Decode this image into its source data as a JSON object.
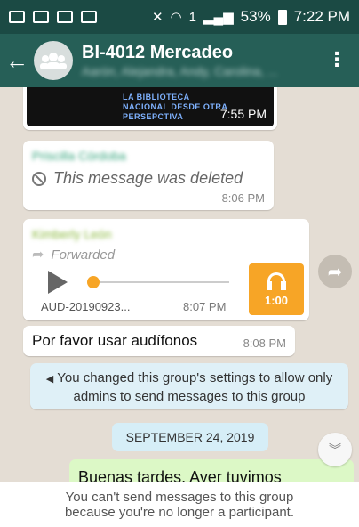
{
  "status_bar": {
    "battery": "53%",
    "time": "7:22 PM",
    "sim_label": "1"
  },
  "header": {
    "title": "BI-4012 Mercadeo",
    "members": "Aarón, Alejandra, Andy, Carolina, ..."
  },
  "messages": {
    "image": {
      "caption_line1": "LA BIBLIOTECA",
      "caption_line2": "NACIONAL DESDE OTRA",
      "caption_line3": "PERSEPCTIVA",
      "time": "7:55 PM"
    },
    "deleted": {
      "sender": "Priscilla Córdoba",
      "text": "This message was deleted",
      "time": "8:06 PM"
    },
    "audio": {
      "sender": "Kimberly León",
      "forwarded_label": "Forwarded",
      "file_name": "AUD-20190923...",
      "time": "8:07 PM",
      "duration": "1:00",
      "progress": 0.0
    },
    "text": {
      "body": "Por favor usar audífonos",
      "time": "8:08 PM"
    },
    "system": {
      "text": "You changed this group's settings to allow only admins to send messages to this group"
    },
    "date_separator": "SEPTEMBER 24, 2019",
    "partial": {
      "text": "Buenas tardes. Ayer tuvimos"
    }
  },
  "footer": {
    "text": "You can't send messages to this group because you're no longer a participant."
  },
  "colors": {
    "app_bar": "#265f57",
    "status_bar": "#1b4a44",
    "chat_background": "#e4ddd4",
    "accent_orange": "#f7a526",
    "outgoing_bubble": "#dcf8c6",
    "system_bubble": "#dff0f7"
  },
  "icons": {
    "back": "arrow-left-icon",
    "group_avatar": "group-icon",
    "menu": "more-vertical-icon",
    "deleted": "ban-icon",
    "forwarded": "forward-arrow-icon",
    "play": "play-icon",
    "audio": "headphones-icon",
    "share": "forward-share-icon",
    "scroll_down": "double-chevron-down-icon",
    "system": "speaker-icon"
  }
}
